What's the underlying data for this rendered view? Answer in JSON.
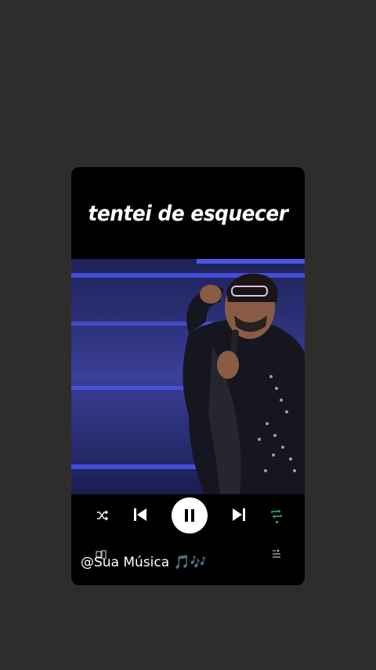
{
  "post": {
    "title": "tentei de esquecer",
    "credit": "@Sua Música 🎵🎶"
  },
  "player": {
    "state": "playing",
    "icons": [
      "shuffle-icon",
      "previous-icon",
      "pause-icon",
      "next-icon",
      "repeat-icon",
      "device-icon",
      "queue-icon"
    ],
    "colors": {
      "repeat_active": "#21c06e",
      "background": "#000000",
      "page": "#2f2d2c"
    }
  }
}
